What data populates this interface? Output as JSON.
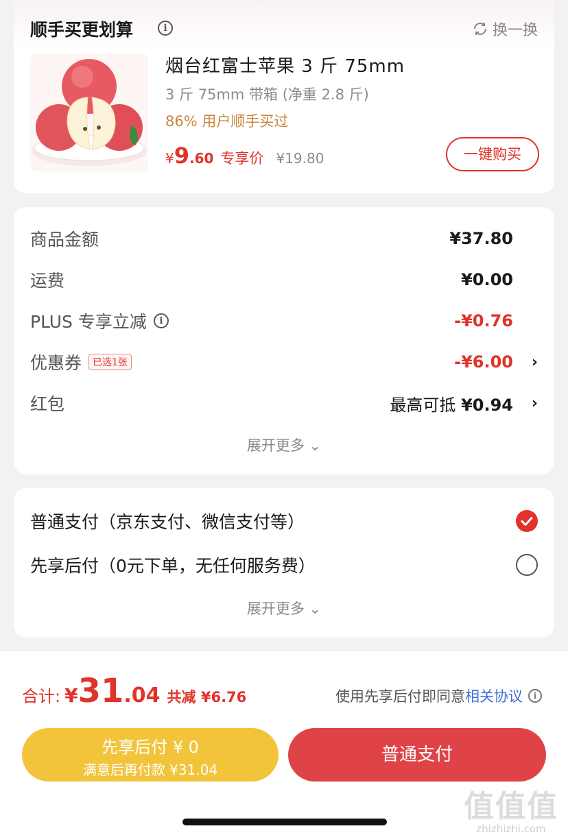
{
  "deal": {
    "title": "顺手买更划算",
    "swap_label": "换一换",
    "product": {
      "name": "烟台红富士苹果 3 斤 75mm",
      "spec": "3 斤 75mm 带箱 (净重 2.8 斤)",
      "buyers": "86% 用户顺手买过",
      "price_yen": "¥",
      "price_int": "9",
      "price_dec": ".60",
      "price_tag": "专享价",
      "original_price": "¥19.80"
    },
    "buy_button": "一键购买"
  },
  "amounts": {
    "rows": [
      {
        "label": "商品金额",
        "value": "¥37.80"
      },
      {
        "label": "运费",
        "value": "¥0.00"
      },
      {
        "label": "PLUS 专享立减",
        "value": "-¥0.76"
      },
      {
        "label": "优惠券",
        "badge": "已选1张",
        "value": "-¥6.00"
      },
      {
        "label": "红包",
        "value_prefix": "最高可抵",
        "value": "¥0.94"
      }
    ],
    "expand": "展开更多"
  },
  "payment": {
    "options": [
      {
        "label": "普通支付（京东支付、微信支付等）",
        "selected": true
      },
      {
        "label": "先享后付（0元下单，无任何服务费）",
        "selected": false
      }
    ],
    "expand": "展开更多"
  },
  "footer": {
    "total_label": "合计:",
    "total_yen": "¥",
    "total_int": "31",
    "total_dec": ".04",
    "total_saved": "共减 ¥6.76",
    "agree_text": "使用先享后付即同意",
    "agree_link": "相关协议",
    "btn_later_line1": "先享后付 ¥ 0",
    "btn_later_line2": "满意后再付款 ¥31.04",
    "btn_normal": "普通支付"
  },
  "watermark": {
    "main": "值值值",
    "sub": "zhizhizhi.com"
  },
  "colors": {
    "accent": "#e1332a",
    "pay_later": "#f2c43c",
    "link": "#3c6fd6",
    "buyers": "#c7873c"
  },
  "icons": [
    "info-icon",
    "refresh-icon",
    "chevron-right-icon",
    "chevron-down-icon",
    "check-icon"
  ]
}
